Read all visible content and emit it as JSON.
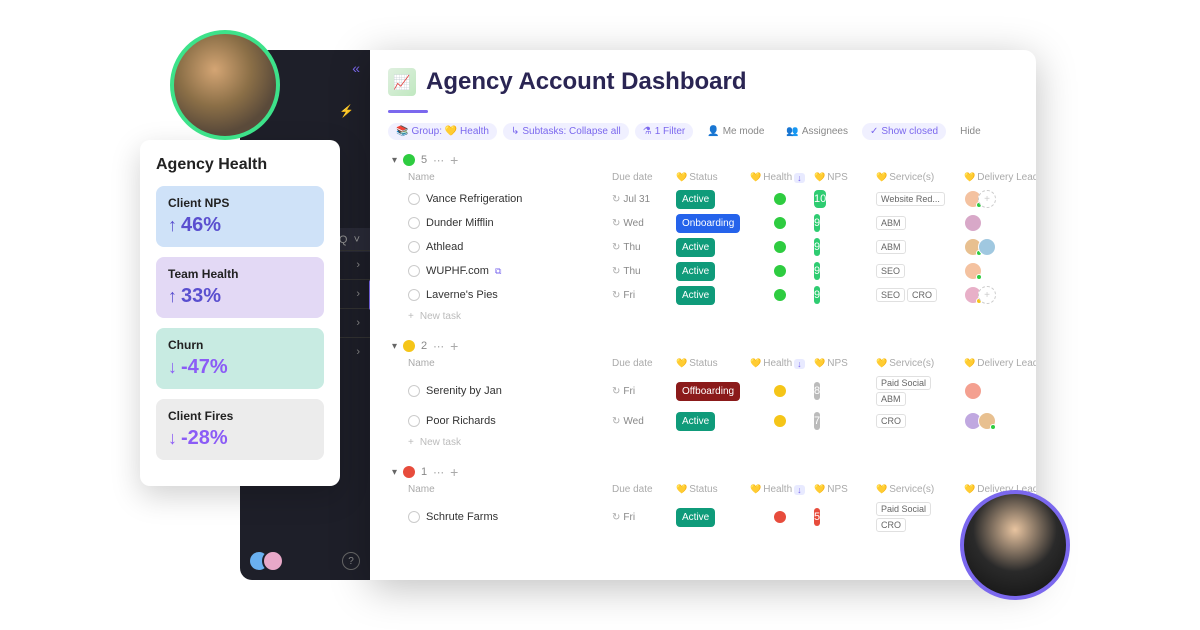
{
  "page": {
    "title": "Agency Account Dashboard"
  },
  "toolbar": {
    "group": "Group: 💛 Health",
    "subtasks": "Subtasks: Collapse all",
    "filter": "1 Filter",
    "me_mode": "Me mode",
    "assignees": "Assignees",
    "show_closed": "Show closed",
    "hide": "Hide"
  },
  "columns": {
    "name": "Name",
    "due_date": "Due date",
    "status": "Status",
    "health": "Health",
    "nps": "NPS",
    "services": "Service(s)",
    "delivery_lead": "Delivery Lead"
  },
  "groups": [
    {
      "health": "green",
      "count": "5",
      "rows": [
        {
          "name": "Vance Refrigeration",
          "due": "Jul 31",
          "status": "Active",
          "status_class": "active",
          "health": "green",
          "nps": "10",
          "nps_class": "green",
          "services": [
            "Website Red..."
          ],
          "leads": [
            {
              "color": "#f4c2a0",
              "dot": "green"
            },
            {
              "add": true
            }
          ]
        },
        {
          "name": "Dunder Mifflin",
          "due": "Wed",
          "status": "Onboarding",
          "status_class": "onboarding",
          "health": "green",
          "nps": "9",
          "nps_class": "green",
          "services": [
            "ABM"
          ],
          "leads": [
            {
              "color": "#d8a8c8",
              "dot": ""
            }
          ]
        },
        {
          "name": "Athlead",
          "due": "Thu",
          "status": "Active",
          "status_class": "active",
          "health": "green",
          "nps": "9",
          "nps_class": "green",
          "services": [
            "ABM"
          ],
          "leads": [
            {
              "color": "#e8c090",
              "dot": "green"
            },
            {
              "color": "#a0c8e0",
              "dot": ""
            }
          ]
        },
        {
          "name": "WUPHF.com",
          "link": true,
          "due": "Thu",
          "status": "Active",
          "status_class": "active",
          "health": "green",
          "nps": "9",
          "nps_class": "green",
          "services": [
            "SEO"
          ],
          "leads": [
            {
              "color": "#f4c2a0",
              "dot": "green"
            }
          ]
        },
        {
          "name": "Laverne's Pies",
          "due": "Fri",
          "status": "Active",
          "status_class": "active",
          "health": "green",
          "nps": "9",
          "nps_class": "green",
          "services": [
            "SEO",
            "CRO"
          ],
          "leads": [
            {
              "color": "#e8b0c8",
              "dot": "yellow"
            },
            {
              "add": true
            }
          ]
        }
      ]
    },
    {
      "health": "yellow",
      "count": "2",
      "rows": [
        {
          "name": "Serenity by Jan",
          "due": "Fri",
          "status": "Offboarding",
          "status_class": "offboarding",
          "health": "yellow",
          "nps": "8",
          "nps_class": "grey",
          "services": [
            "Paid Social",
            "ABM"
          ],
          "leads": [
            {
              "color": "#f4a090",
              "dot": ""
            }
          ]
        },
        {
          "name": "Poor Richards",
          "due": "Wed",
          "status": "Active",
          "status_class": "active",
          "health": "yellow",
          "nps": "7",
          "nps_class": "grey",
          "services": [
            "CRO"
          ],
          "leads": [
            {
              "color": "#c0a8e0",
              "dot": ""
            },
            {
              "color": "#e8c090",
              "dot": "green"
            }
          ]
        }
      ]
    },
    {
      "health": "red",
      "count": "1",
      "rows": [
        {
          "name": "Schrute Farms",
          "due": "Fri",
          "status": "Active",
          "status_class": "active",
          "health": "red",
          "nps": "5",
          "nps_class": "red",
          "services": [
            "Paid Social",
            "CRO"
          ],
          "leads": []
        }
      ]
    }
  ],
  "new_task_label": "New task",
  "health_card": {
    "title": "Agency Health",
    "metrics": [
      {
        "label": "Client NPS",
        "arrow": "↑",
        "arrow_class": "arrow-up",
        "value": "46%",
        "color": "blue"
      },
      {
        "label": "Team Health",
        "arrow": "↑",
        "arrow_class": "arrow-up",
        "value": "33%",
        "color": "purple"
      },
      {
        "label": "Churn",
        "arrow": "↓",
        "arrow_class": "arrow-down",
        "value": "-47%",
        "color": "teal"
      },
      {
        "label": "Client Fires",
        "arrow": "↓",
        "arrow_class": "arrow-down",
        "value": "-28%",
        "color": "grey"
      }
    ]
  },
  "sidebar": {
    "search": "Q"
  }
}
